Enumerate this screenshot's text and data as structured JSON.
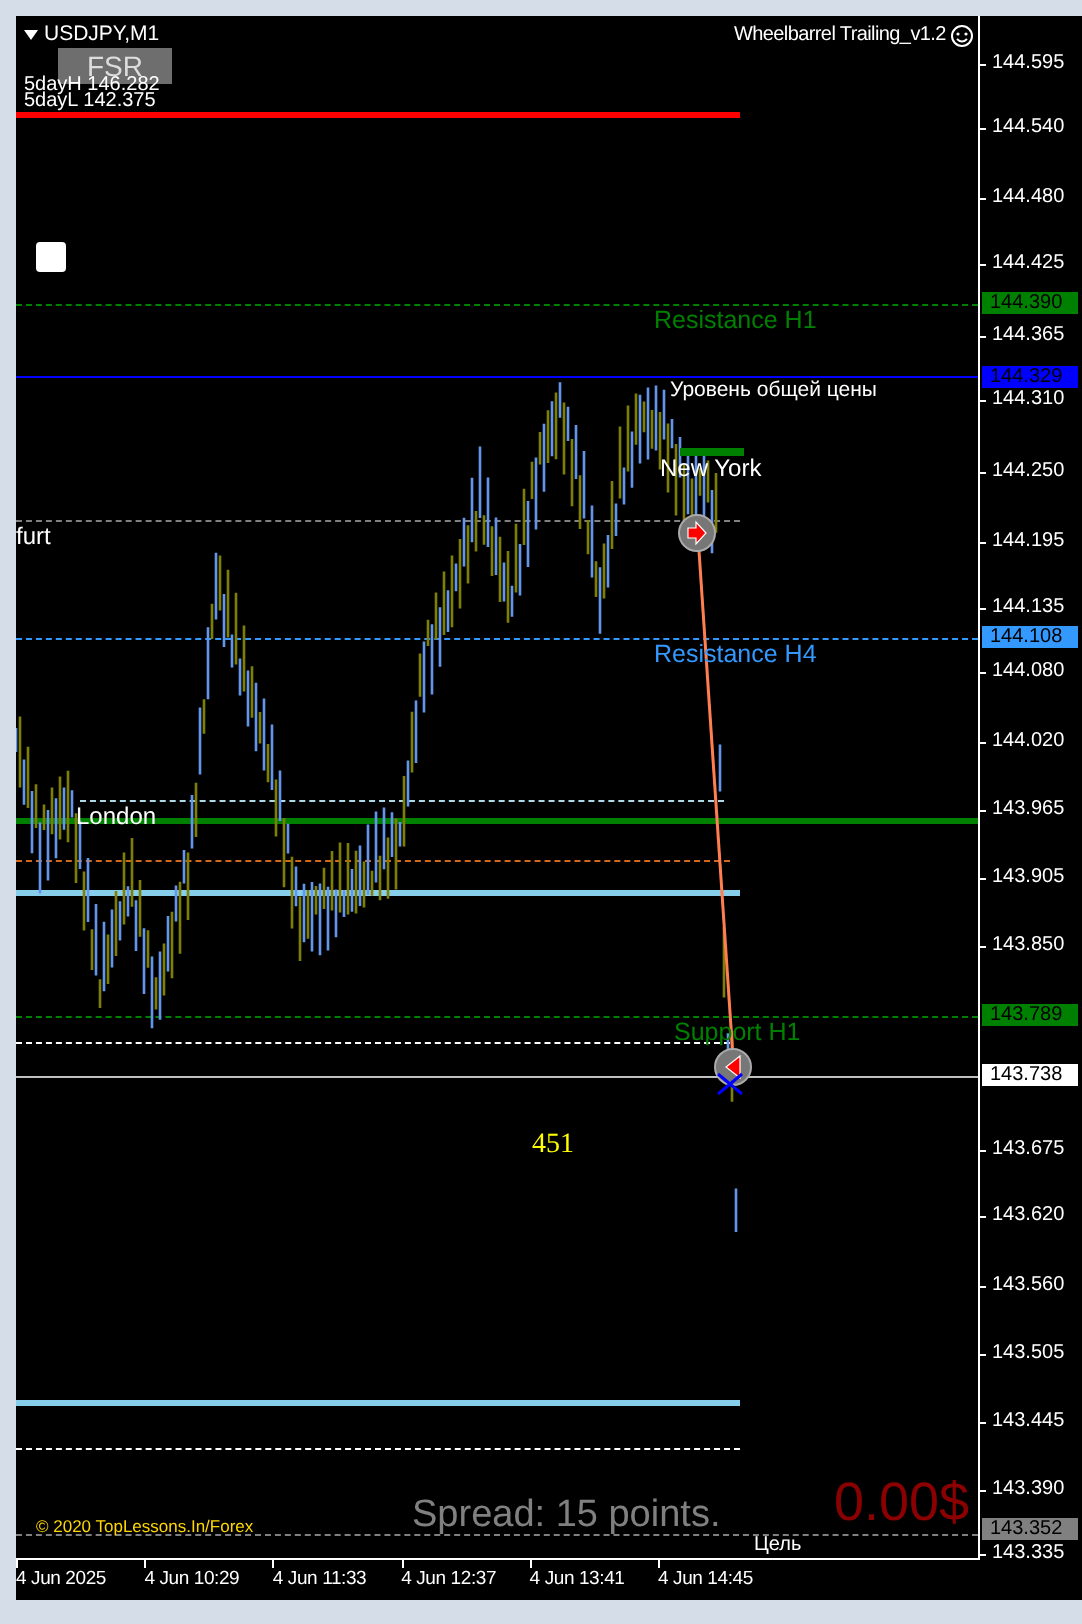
{
  "chart": {
    "symbol": "USDJPY,M1",
    "expert": "Wheelbarrel Trailing_v1.2",
    "fsr_button": "FSR",
    "five_day_high": "5dayH 146.282",
    "five_day_low": "5dayL 142.375"
  },
  "sr_levels": [
    {
      "label": "Resistance H1",
      "color": "#008000"
    },
    {
      "label": "Resistance H4",
      "color": "#3399ff"
    },
    {
      "label": "Support H1",
      "color": "#008000"
    }
  ],
  "common_price_label": "Уровень общей цены",
  "sessions": [
    "furt",
    "London",
    "New York"
  ],
  "counter": "451",
  "copyright": "© 2020 TopLessons.In/Forex",
  "spread": "Spread: 15 points.",
  "profit": "0.00$",
  "target_label": "Цель",
  "price_axis": [
    "144.595",
    "144.540",
    "144.480",
    "144.425",
    "144.365",
    "144.310",
    "144.250",
    "144.195",
    "144.135",
    "144.080",
    "144.020",
    "143.965",
    "143.905",
    "143.850",
    "143.675",
    "143.620",
    "143.560",
    "143.505",
    "143.445",
    "143.390",
    "143.335"
  ],
  "price_tags": [
    {
      "value": "144.390",
      "color": "#008000"
    },
    {
      "value": "144.329",
      "color": "#0000ff"
    },
    {
      "value": "144.108",
      "color": "#3399ff"
    },
    {
      "value": "143.789",
      "color": "#008000"
    },
    {
      "value": "143.738",
      "color": "#ffffff"
    },
    {
      "value": "143.352",
      "color": "#808080"
    }
  ],
  "time_axis": [
    "4 Jun 2025",
    "4 Jun 10:29",
    "4 Jun 11:33",
    "4 Jun 12:37",
    "4 Jun 13:41",
    "4 Jun 14:45"
  ]
}
